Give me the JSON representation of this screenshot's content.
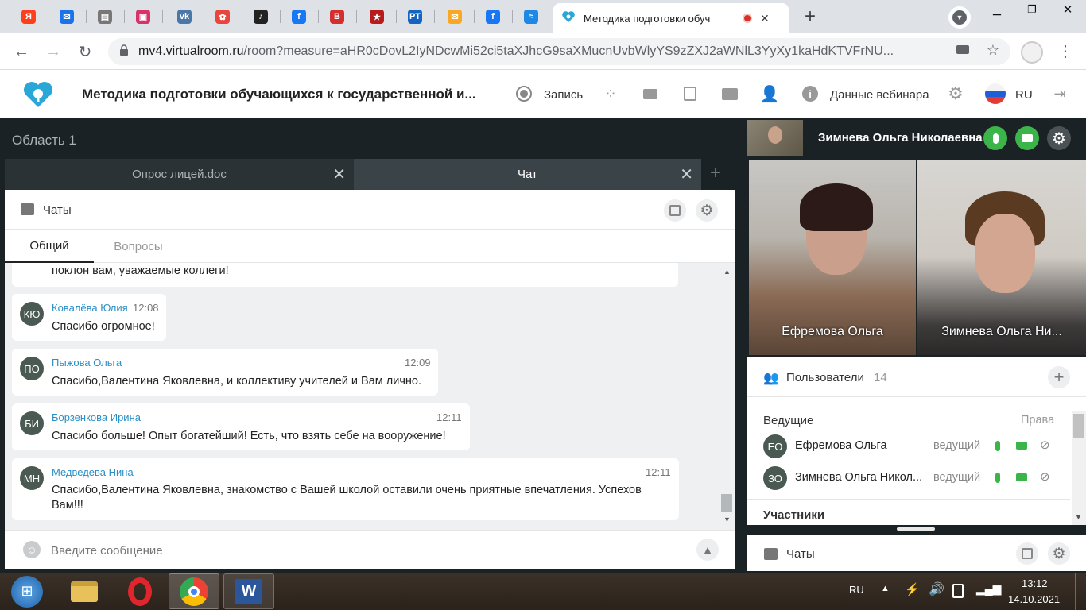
{
  "browser": {
    "pinned_tabs": [
      {
        "icon": "yandex-icon",
        "letter": "Я",
        "color": "#fc3f1d"
      },
      {
        "icon": "mail-icon",
        "letter": "✉",
        "color": "#1a73e8"
      },
      {
        "icon": "document-icon",
        "letter": "▤",
        "color": "#777777"
      },
      {
        "icon": "photo-icon",
        "letter": "▣",
        "color": "#d6336c"
      },
      {
        "icon": "vk-icon",
        "letter": "vk",
        "color": "#4a76a8"
      },
      {
        "icon": "flower-icon",
        "letter": "✿",
        "color": "#e8453c"
      },
      {
        "icon": "music-icon",
        "letter": "♪",
        "color": "#222222"
      },
      {
        "icon": "facebook-icon",
        "letter": "f",
        "color": "#1877f2"
      },
      {
        "icon": "book-icon",
        "letter": "B",
        "color": "#d32f2f"
      },
      {
        "icon": "star-icon",
        "letter": "★",
        "color": "#b71c1c"
      },
      {
        "icon": "rt-icon",
        "letter": "РТ",
        "color": "#1565c0"
      },
      {
        "icon": "envelope-icon",
        "letter": "✉",
        "color": "#f9a825"
      },
      {
        "icon": "facebook-icon",
        "letter": "f",
        "color": "#1877f2"
      },
      {
        "icon": "wave-icon",
        "letter": "≈",
        "color": "#1e88e5"
      }
    ],
    "active_tab_title": "Методика подготовки обуч",
    "url_host": "mv4.virtualroom.ru",
    "url_path": "/room?measure=aHR0cDovL2IyNDcwMi52ci5taXJhcG9saXMucnUvbWlyYS9zZXJ2aWNlL3YyXy1kaHdKTVFrNU..."
  },
  "app": {
    "title": "Методика подготовки обучающихся к государственной и...",
    "record_label": "Запись",
    "webinar_data_label": "Данные вебинара",
    "language": "RU"
  },
  "area": {
    "title": "Область 1",
    "tabs": [
      {
        "label": "Опрос лицей.doc"
      },
      {
        "label": "Чат"
      }
    ]
  },
  "chat": {
    "header": "Чаты",
    "subtabs": [
      "Общий",
      "Вопросы"
    ],
    "partial_message": "поклон вам, уважаемые коллеги!",
    "messages": [
      {
        "initials": "КЮ",
        "name": "Ковалёва Юлия",
        "time": "12:08",
        "text": "Спасибо огромное!"
      },
      {
        "initials": "ПО",
        "name": "Пыжова Ольга",
        "time": "12:09",
        "text": "Спасибо,Валентина Яковлевна, и коллективу учителей и Вам лично."
      },
      {
        "initials": "БИ",
        "name": "Борзенкова Ирина",
        "time": "12:11",
        "text": "Спасибо больше! Опыт богатейший! Есть, что взять себе на вооружение!"
      },
      {
        "initials": "МН",
        "name": "Медведева Нина",
        "time": "12:11",
        "text_line1": "Спасибо,Валентина Яковлевна, знакомство с Вашей школой оставили очень приятные впечатления. Успехов",
        "text_line2": "Вам!!!"
      }
    ],
    "input_placeholder": "Введите сообщение"
  },
  "self_user": {
    "name": "Зимнева Ольга Николаевна"
  },
  "videos": [
    {
      "label": "Ефремова Ольга"
    },
    {
      "label": "Зимнева Ольга Ни..."
    }
  ],
  "users": {
    "title": "Пользователи",
    "count": "14",
    "hosts_label": "Ведущие",
    "rights_label": "Права",
    "hosts": [
      {
        "initials": "ЕО",
        "name": "Ефремова Ольга",
        "role": "ведущий"
      },
      {
        "initials": "ЗО",
        "name": "Зимнева Ольга Никол...",
        "role": "ведущий"
      }
    ],
    "participants_label": "Участники"
  },
  "right_chats": {
    "label": "Чаты"
  },
  "taskbar": {
    "lang": "RU",
    "time": "13:12",
    "date": "14.10.2021"
  }
}
